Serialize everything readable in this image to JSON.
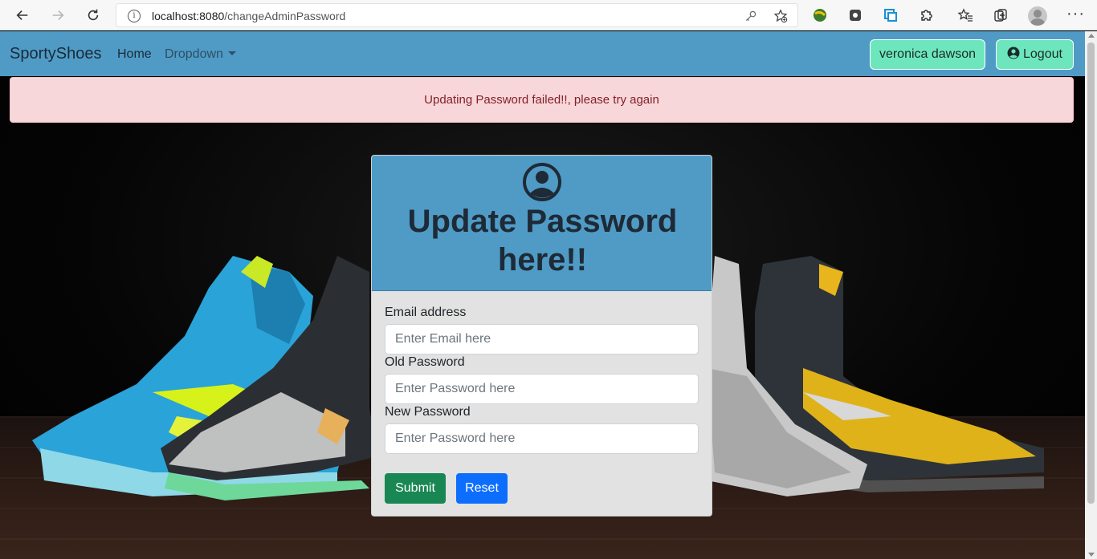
{
  "browser": {
    "url_host": "localhost:8080",
    "url_path": "/changeAdminPassword"
  },
  "navbar": {
    "brand": "SportyShoes",
    "home": "Home",
    "dropdown": "Dropdown",
    "user_name": "veronica dawson",
    "logout": "Logout"
  },
  "alert": {
    "message": "Updating Password failed!!, please try again",
    "color": "#842029",
    "background": "#f8d7da"
  },
  "card": {
    "title": "Update Password here!!",
    "email_label": "Email address",
    "email_placeholder": "Enter Email here",
    "old_password_label": "Old Password",
    "old_password_placeholder": "Enter Password here",
    "new_password_label": "New Password",
    "new_password_placeholder": "Enter Password here",
    "submit": "Submit",
    "reset": "Reset"
  },
  "colors": {
    "navbar": "#4f9bc6",
    "user_button": "#6ee6bd",
    "submit": "#198754",
    "reset": "#0d6efd"
  },
  "icons": [
    "back-icon",
    "forward-icon",
    "reload-icon",
    "info-icon",
    "key-icon",
    "favorite-add-icon",
    "extension-icon",
    "favorites-icon",
    "collections-icon",
    "profile-icon",
    "more-icon",
    "user-circle-icon"
  ]
}
